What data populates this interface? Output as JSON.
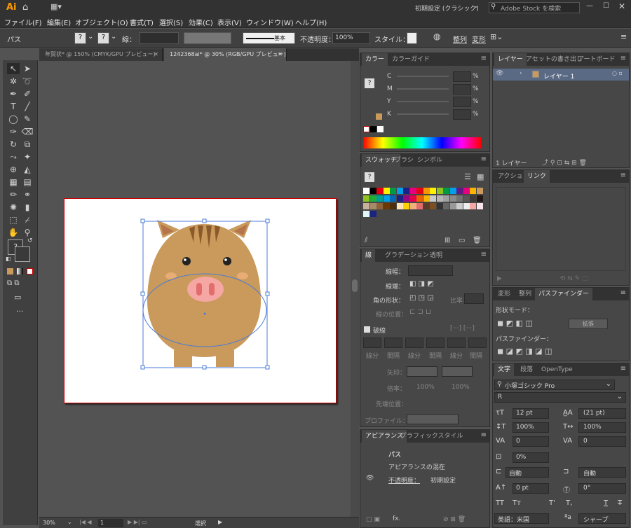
{
  "app": {
    "logo": "Ai",
    "workspace": "初期設定 (クラシック)",
    "stock_search_placeholder": "Adobe Stock を検索"
  },
  "menubar": [
    "ファイル(F)",
    "編集(E)",
    "オブジェクト(O)",
    "書式(T)",
    "選択(S)",
    "効果(C)",
    "表示(V)",
    "ウィンドウ(W)",
    "ヘルプ(H)"
  ],
  "control": {
    "object_type": "パス",
    "fill_label": "?",
    "stroke_label": "?",
    "stroke_text": "線：",
    "brush": "基本",
    "opacity_label": "不透明度：",
    "opacity_value": "100%",
    "style_label": "スタイル：",
    "align": "整列",
    "transform": "変形"
  },
  "doc_tabs": [
    "年賀状* @ 150% (CMYK/GPU プレビュー)",
    "1242368ai* @ 30% (RGB/GPU プレビュー)"
  ],
  "status": {
    "zoom": "30%",
    "page": "1",
    "mode": "選択"
  },
  "color_panel": {
    "tabs": [
      "カラー",
      "カラーガイド"
    ],
    "channels": [
      "C",
      "M",
      "Y",
      "K"
    ],
    "pct": "%"
  },
  "swatch_panel": {
    "tabs": [
      "スウォッチ",
      "ブラシ",
      "シンボル"
    ]
  },
  "stroke_panel": {
    "tabs": [
      "線",
      "グラデーション",
      "透明"
    ],
    "width_label": "線幅：",
    "cap_label": "線端：",
    "corner_label": "角の形状：",
    "limit_label": "比率：",
    "align_label": "線の位置：",
    "dash_label": "破線",
    "dash_cells": [
      "線分",
      "間隔",
      "線分",
      "間隔",
      "線分",
      "間隔"
    ],
    "arrow_label": "矢印：",
    "scale_label": "倍率：",
    "scale_1": "100%",
    "scale_2": "100%",
    "tip_label": "先端位置：",
    "profile_label": "プロファイル："
  },
  "appearance_panel": {
    "tabs": [
      "アピアランス",
      "グラフィックスタイル"
    ],
    "rows": [
      "パス",
      "アピアランスの混在",
      "不透明度：",
      "初期設定"
    ],
    "fx": "fx."
  },
  "layers_panel": {
    "tabs": [
      "レイヤー",
      "アセットの書き出し",
      "アートボード"
    ],
    "layer_name": "レイヤー 1",
    "count": "1 レイヤー"
  },
  "actions_panel": {
    "tabs": [
      "アクション",
      "リンク"
    ]
  },
  "pathfinder_panel": {
    "tabs": [
      "変形",
      "整列",
      "パスファインダー"
    ],
    "shape_mode": "形状モード：",
    "expand": "拡張",
    "pathfinder": "パスファインダー："
  },
  "type_panel": {
    "tabs": [
      "文字",
      "段落",
      "OpenType"
    ],
    "font": "小塚ゴシック Pro",
    "style": "R",
    "size": "12 pt",
    "leading": "(21 pt)",
    "vscale": "100%",
    "hscale": "100%",
    "kerning": "0",
    "tracking": "0",
    "tsume": "0%",
    "aki_left": "自動",
    "aki_right": "自動",
    "baseline": "0 pt",
    "rotation": "0°",
    "language": "英語：米国",
    "aa": "シャープ",
    "tt_buttons": [
      "TT",
      "Tт",
      "T'",
      "T,",
      "T",
      "T"
    ]
  },
  "colors": {
    "boar_body": "#c99a5b",
    "boar_ear_inner": "#b5744a",
    "boar_nose": "#f4a7a3",
    "boar_nostril": "#e36d6d",
    "selection": "#4a7bd8",
    "artboard_border": "#cc0000"
  }
}
